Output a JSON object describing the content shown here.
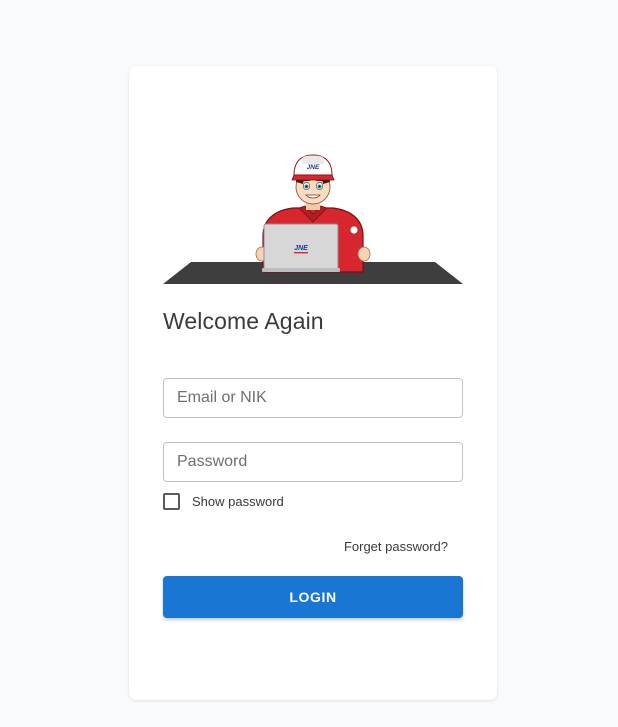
{
  "login": {
    "title": "Welcome Again",
    "email_placeholder": "Email or NIK",
    "password_placeholder": "Password",
    "show_password_label": "Show password",
    "forget_password": "Forget password?",
    "login_button": "LOGIN"
  },
  "illustration": {
    "cap_logo": "JNE",
    "laptop_logo": "JNE"
  },
  "colors": {
    "page_background": "#f7fbfe",
    "primary_button": "#1976d2",
    "card_background": "#ffffff",
    "courier_shirt": "#d8262e",
    "desk": "#3e3e3e"
  }
}
